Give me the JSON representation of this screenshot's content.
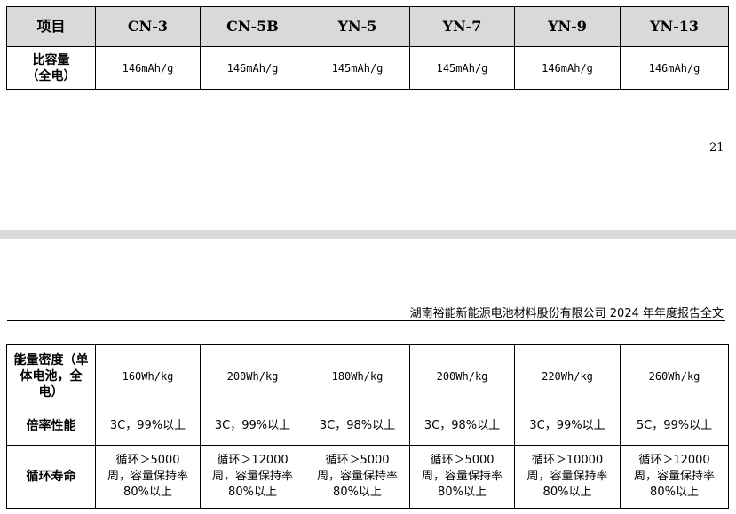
{
  "table_top": {
    "header": [
      "项目",
      "CN-3",
      "CN-5B",
      "YN-5",
      "YN-7",
      "YN-9",
      "YN-13"
    ],
    "rows": [
      {
        "label": [
          "比容量",
          "（全电）"
        ],
        "cells": [
          "146mAh/g",
          "146mAh/g",
          "145mAh/g",
          "145mAh/g",
          "146mAh/g",
          "146mAh/g"
        ]
      }
    ]
  },
  "page_number": "21",
  "doc_header": "湖南裕能新能源电池材料股份有限公司 2024 年年度报告全文",
  "table_bottom": {
    "rows": [
      {
        "label": [
          "能量密度（单",
          "体电池，全",
          "电）"
        ],
        "cells": [
          [
            "160Wh/kg"
          ],
          [
            "200Wh/kg"
          ],
          [
            "180Wh/kg"
          ],
          [
            "200Wh/kg"
          ],
          [
            "220Wh/kg"
          ],
          [
            "260Wh/kg"
          ]
        ]
      },
      {
        "label": [
          "倍率性能"
        ],
        "cells": [
          [
            "3C，99%以上"
          ],
          [
            "3C，99%以上"
          ],
          [
            "3C，98%以上"
          ],
          [
            "3C，98%以上"
          ],
          [
            "3C，99%以上"
          ],
          [
            "5C，99%以上"
          ]
        ]
      },
      {
        "label": [
          "循环寿命"
        ],
        "cells": [
          [
            "循环＞5000",
            "周，容量保持率",
            "80%以上"
          ],
          [
            "循环＞12000",
            "周，容量保持率",
            "80%以上"
          ],
          [
            "循环＞5000",
            "周，容量保持率",
            "80%以上"
          ],
          [
            "循环＞5000",
            "周，容量保持率",
            "80%以上"
          ],
          [
            "循环＞10000",
            "周，容量保持率",
            "80%以上"
          ],
          [
            "循环＞12000",
            "周，容量保持率",
            "80%以上"
          ]
        ]
      }
    ]
  }
}
